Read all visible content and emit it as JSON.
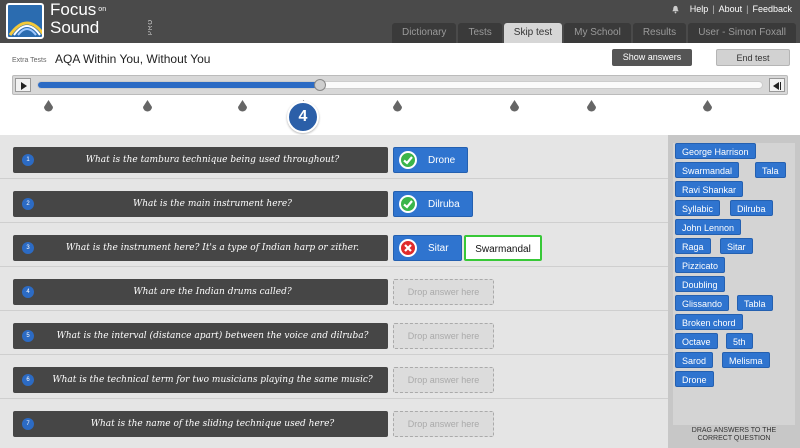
{
  "brand": {
    "line1": "Focus",
    "on": "on",
    "line2": "Sound",
    "pro": "PRO"
  },
  "top_links": [
    "Help",
    "About",
    "Feedback"
  ],
  "nav_tabs": [
    {
      "label": "Dictionary",
      "active": false
    },
    {
      "label": "Tests",
      "active": false
    },
    {
      "label": "Skip test",
      "active": true
    },
    {
      "label": "My School",
      "active": false
    },
    {
      "label": "Results",
      "active": false
    },
    {
      "label": "User - Simon Foxall",
      "active": false
    }
  ],
  "test": {
    "section": "Extra Tests",
    "title": "AQA Within You, Without You"
  },
  "buttons": {
    "show_answers": "Show answers",
    "end_test": "End test"
  },
  "player": {
    "progress_fraction": 0.39,
    "current_question": "4"
  },
  "questions": [
    {
      "num": "1",
      "text": "What is the tambura technique being used throughout?",
      "answer": "Drone",
      "status": "correct"
    },
    {
      "num": "2",
      "text": "What is the main instrument here?",
      "answer": "Dilruba",
      "status": "correct"
    },
    {
      "num": "3",
      "text": "What is the instrument here? It's a type of Indian harp or zither.",
      "answer": "Sitar",
      "status": "wrong",
      "correct_answer": "Swarmandal"
    },
    {
      "num": "4",
      "text": "What are the Indian drums called?",
      "drop_label": "Drop answer here"
    },
    {
      "num": "5",
      "text": "What is the interval (distance apart) between the voice and dilruba?",
      "drop_label": "Drop answer here"
    },
    {
      "num": "6",
      "text": "What is the technical term for two musicians playing the same music?",
      "drop_label": "Drop answer here"
    },
    {
      "num": "7",
      "text": "What is the name of the sliding technique used here?",
      "drop_label": "Drop answer here"
    }
  ],
  "answer_bank": {
    "chips": [
      "George Harrison",
      "Swarmandal",
      "Tala",
      "Ravi Shankar",
      "Syllabic",
      "Dilruba",
      "John Lennon",
      "Raga",
      "Sitar",
      "Pizzicato",
      "Doubling",
      "Glissando",
      "Tabla",
      "Broken chord",
      "Octave",
      "5th",
      "Sarod",
      "Melisma",
      "Drone"
    ],
    "footer_line1": "DRAG ANSWERS TO THE",
    "footer_line2": "CORRECT QUESTION"
  },
  "colors": {
    "accent_blue": "#2f74cf",
    "correct_green": "#3bb54a",
    "wrong_red": "#e02b2b",
    "header_dark": "#4a4a4a"
  },
  "icons": {
    "correct": "check-icon",
    "wrong": "cross-icon",
    "notification": "bell-icon"
  }
}
